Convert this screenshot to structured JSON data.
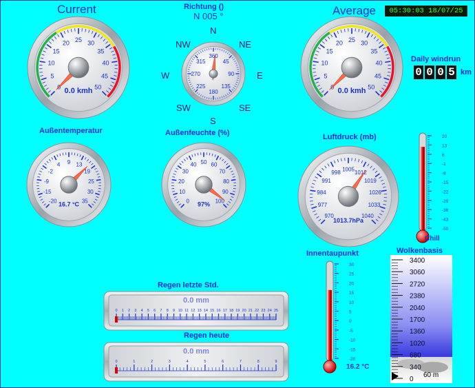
{
  "clock": "05:30:03 18/07/25",
  "wind_current": {
    "title": "Current",
    "ticks": [
      "0",
      "5",
      "10",
      "15",
      "20",
      "25",
      "30",
      "35",
      "40",
      "45",
      "50"
    ],
    "value": 0.0,
    "label": "0.0 kmh"
  },
  "wind_average": {
    "title": "Average",
    "ticks": [
      "0",
      "5",
      "10",
      "15",
      "20",
      "25",
      "30",
      "35",
      "40",
      "45",
      "50"
    ],
    "value": 0.0,
    "label": "0.0 kmh"
  },
  "direction": {
    "title": "Richtung ()",
    "reading": "N  005 °",
    "points": {
      "n": "N",
      "ne": "NE",
      "e": "E",
      "se": "SE",
      "s": "S",
      "sw": "SW",
      "w": "W",
      "nw": "NW"
    },
    "ticks": [
      "360",
      "45",
      "90",
      "135",
      "180",
      "225",
      "270",
      "315"
    ],
    "heading": 5
  },
  "daily_windrun": {
    "title": "Daily windrun",
    "digits": [
      "0",
      "0",
      "0",
      "5"
    ],
    "unit": "km"
  },
  "temperature": {
    "title": "Außentemperatur",
    "ticks": [
      "-20",
      "-15",
      "-9",
      "-2",
      "4",
      "9",
      "13",
      "19",
      "25",
      "30",
      "35"
    ],
    "value": 16.7,
    "label": "16.7 °C"
  },
  "humidity": {
    "title": "Außenfeuchte (%)",
    "ticks": [
      "0",
      "10",
      "20",
      "30",
      "40",
      "50",
      "60",
      "70",
      "80",
      "90",
      "100"
    ],
    "value": 97,
    "label": "97%"
  },
  "pressure": {
    "title": "Luftdruck (mb)",
    "ticks": [
      "970",
      "977",
      "984",
      "991",
      "998",
      "1005",
      "1012",
      "1019",
      "1026",
      "1033",
      "1040"
    ],
    "value": 1013.7,
    "label": "1013.7hPa"
  },
  "windchill": {
    "ticks": [
      "20",
      "13",
      "6",
      "-1",
      "-8",
      "-15",
      "-22",
      "-29",
      "-36",
      "-43",
      "-50"
    ],
    "label": "Chill"
  },
  "dewpoint": {
    "title": "Innentaupunkt",
    "ticks": [
      "30",
      "25",
      "20",
      "15",
      "10",
      "5",
      "0",
      "-5",
      "-10",
      "-15",
      "-20"
    ],
    "value": 16.2,
    "label": "16.2 °C"
  },
  "cloudbase": {
    "title": "Wolkenbasis",
    "ticks": [
      "3400",
      "3060",
      "2720",
      "2380",
      "2040",
      "1700",
      "1360",
      "1020",
      "680",
      "340",
      "0"
    ],
    "value": 60,
    "label": "60 m"
  },
  "rain_hour": {
    "title": "Regen letzte Std.",
    "label": "0.0 mm",
    "ticks": [
      "0",
      "1",
      "2",
      "3",
      "4",
      "5",
      "6",
      "7",
      "8",
      "9",
      "10",
      "11",
      "12",
      "13",
      "14",
      "15",
      "16",
      "17",
      "18",
      "19",
      "20",
      "21",
      "22",
      "23",
      "24",
      "25"
    ],
    "value": 0.0
  },
  "rain_today": {
    "title": "Regen heute",
    "label": "0.0 mm",
    "ticks": [
      "0",
      "1",
      "2",
      "3",
      "4",
      "5",
      "6",
      "7",
      "8",
      "9"
    ],
    "value": 0.0
  }
}
